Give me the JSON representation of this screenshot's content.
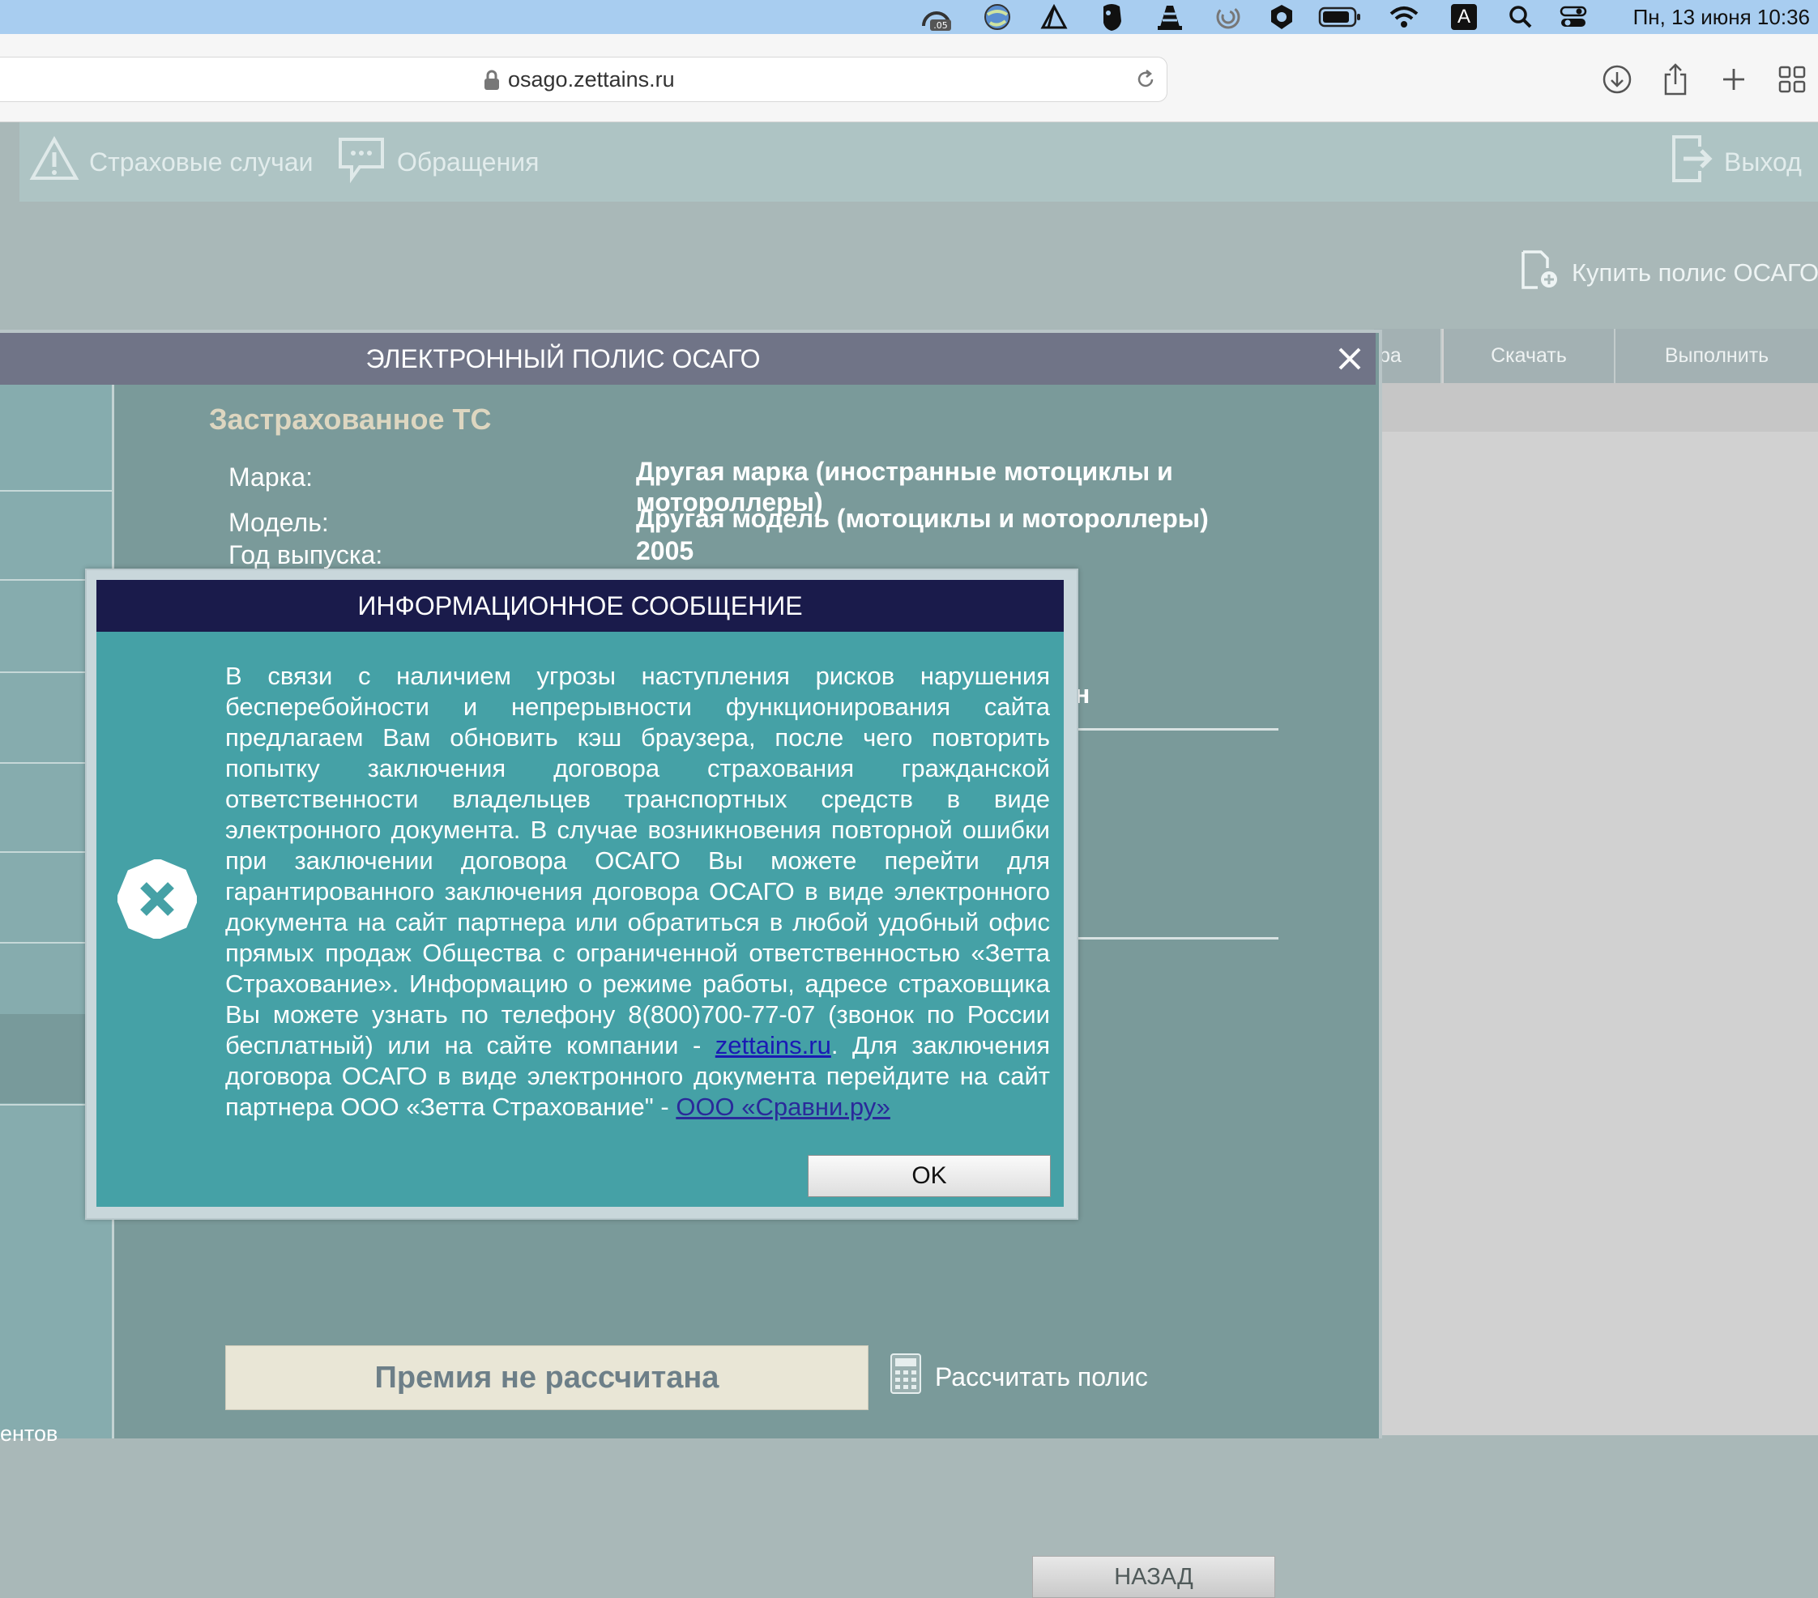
{
  "menubar": {
    "clock": "Пн, 13 июня  10:36",
    "badge": ".05",
    "input_source": "A",
    "icons": [
      "activity-monitor-icon",
      "globe-icon",
      "affinity-icon",
      "evernote-icon",
      "vlc-icon",
      "sync-icon",
      "shield-icon",
      "battery-icon",
      "wifi-icon",
      "input-source-icon",
      "spotlight-icon",
      "control-center-icon"
    ]
  },
  "browser": {
    "url": "osago.zettains.ru",
    "buttons": [
      "download-icon",
      "share-icon",
      "new-tab-icon",
      "tab-overview-icon"
    ]
  },
  "site_nav": {
    "insurance_cases": "Страховые случаи",
    "appeals": "Обращения",
    "logout": "Выход",
    "buy_policy": "Купить полис ОСАГО"
  },
  "background_table": {
    "headers": [
      "ра",
      "Скачать",
      "Выполнить"
    ]
  },
  "policy_dialog": {
    "title": "ЭЛЕКТРОННЫЙ ПОЛИС ОСАГО",
    "section_title": "Застрахованное ТС",
    "fields": [
      {
        "label": "Марка:",
        "value": "Другая марка (иностранные мотоциклы и мотороллеры)"
      },
      {
        "label": "Модель:",
        "value": "Другая модель (мотоциклы и мотороллеры)"
      },
      {
        "label": "Год выпуска:",
        "value": "2005"
      }
    ],
    "partial_label": "н",
    "left_strip_label": "ентов",
    "premium": "Премия не рассчитана",
    "calc_button": "Рассчитать полис",
    "back_button": "НАЗАД"
  },
  "info_modal": {
    "title": "ИНФОРМАЦИОННОЕ СООБЩЕНИЕ",
    "text_part1": "В связи с наличием угрозы наступления рисков нарушения бесперебойности и непрерывности функционирования сайта предлагаем Вам обновить кэш браузера, после чего повторить попытку заключения договора страхования гражданской ответственности владельцев транспортных средств в виде электронного документа. В случае возникновения повторной ошибки при заключении договора ОСАГО Вы можете перейти для гарантированного заключения договора ОСАГО в виде электронного документа на сайт партнера или обратиться в любой удобный офис прямых продаж Общества с ограниченной ответственностью «Зетта Страхование». Информацию о режиме работы, адресе страховщика Вы можете узнать по телефону 8(800)700-77-07 (звонок по России бесплатный) или на сайте компании - ",
    "link1": "zettains.ru",
    "text_part2": ". Для заключения договора ОСАГО в виде электронного документа перейдите на сайт партнера ООО «Зетта Страхование\" - ",
    "link2": "ООО «Сравни.ру»",
    "ok_button": "OK"
  }
}
